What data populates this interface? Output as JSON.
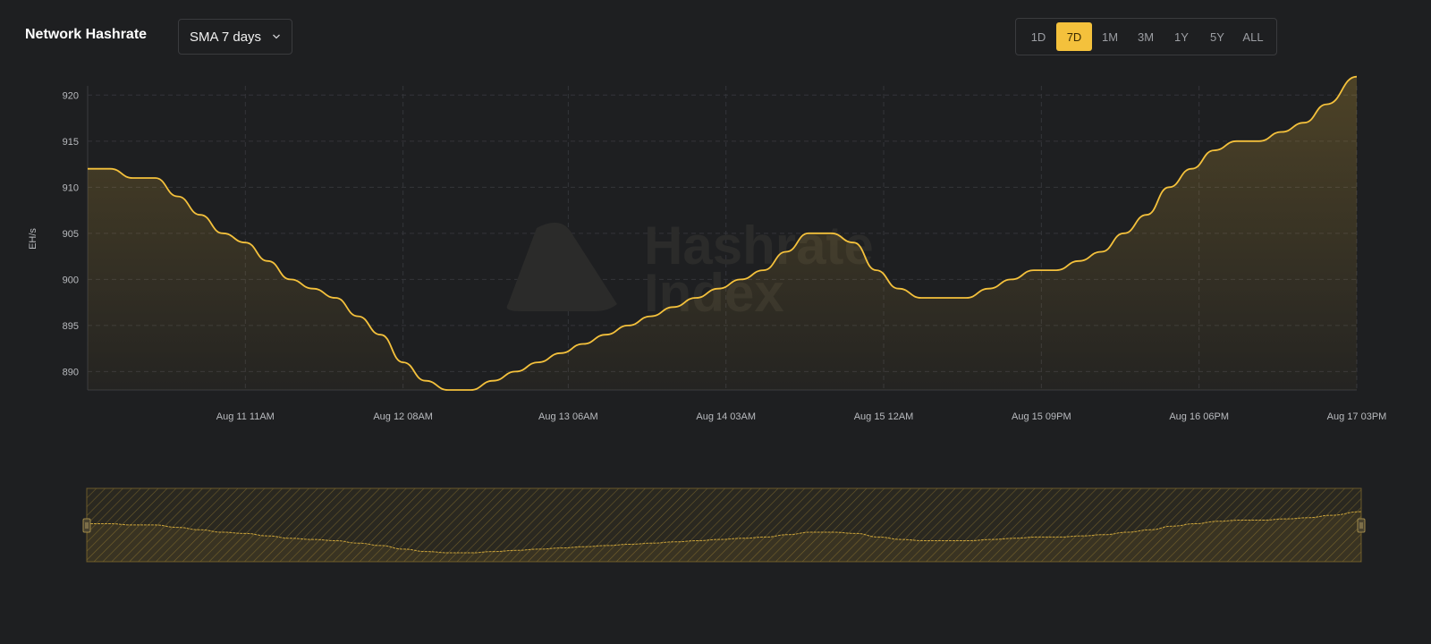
{
  "header": {
    "title": "Network Hashrate",
    "sma_select": {
      "value": "SMA 7 days"
    }
  },
  "range_buttons": [
    "1D",
    "7D",
    "1M",
    "3M",
    "1Y",
    "5Y",
    "ALL"
  ],
  "active_range": "7D",
  "watermark": {
    "line1": "Hashrate",
    "line2": "Index"
  },
  "colors": {
    "accent": "#f4c13c",
    "background": "#1e1f21",
    "grid": "#34353a",
    "text_muted": "#b9bbbf"
  },
  "chart_data": {
    "type": "area",
    "title": "Network Hashrate",
    "ylabel": "EH/s",
    "xlabel": "",
    "ylim": [
      888,
      921
    ],
    "yticks": [
      890,
      895,
      900,
      905,
      910,
      915,
      920
    ],
    "xlim": [
      "Aug 10 14:00",
      "Aug 17 15:00"
    ],
    "xticks": [
      {
        "t": "Aug 11 11:00",
        "label": "Aug 11 11AM"
      },
      {
        "t": "Aug 12 08:00",
        "label": "Aug 12 08AM"
      },
      {
        "t": "Aug 13 06:00",
        "label": "Aug 13 06AM"
      },
      {
        "t": "Aug 14 03:00",
        "label": "Aug 14 03AM"
      },
      {
        "t": "Aug 15 00:00",
        "label": "Aug 15 12AM"
      },
      {
        "t": "Aug 15 21:00",
        "label": "Aug 15 09PM"
      },
      {
        "t": "Aug 16 18:00",
        "label": "Aug 16 06PM"
      },
      {
        "t": "Aug 17 15:00",
        "label": "Aug 17 03PM"
      }
    ],
    "grid": true,
    "series": [
      {
        "values": [
          [
            "Aug 10 14:00",
            912
          ],
          [
            "Aug 10 17:00",
            912
          ],
          [
            "Aug 10 20:00",
            911
          ],
          [
            "Aug 10 23:00",
            911
          ],
          [
            "Aug 11 02:00",
            909
          ],
          [
            "Aug 11 05:00",
            907
          ],
          [
            "Aug 11 08:00",
            905
          ],
          [
            "Aug 11 11:00",
            904
          ],
          [
            "Aug 11 14:00",
            902
          ],
          [
            "Aug 11 17:00",
            900
          ],
          [
            "Aug 11 20:00",
            899
          ],
          [
            "Aug 11 23:00",
            898
          ],
          [
            "Aug 12 02:00",
            896
          ],
          [
            "Aug 12 05:00",
            894
          ],
          [
            "Aug 12 08:00",
            891
          ],
          [
            "Aug 12 11:00",
            889
          ],
          [
            "Aug 12 14:00",
            888
          ],
          [
            "Aug 12 17:00",
            888
          ],
          [
            "Aug 12 20:00",
            889
          ],
          [
            "Aug 12 23:00",
            890
          ],
          [
            "Aug 13 02:00",
            891
          ],
          [
            "Aug 13 05:00",
            892
          ],
          [
            "Aug 13 08:00",
            893
          ],
          [
            "Aug 13 11:00",
            894
          ],
          [
            "Aug 13 14:00",
            895
          ],
          [
            "Aug 13 17:00",
            896
          ],
          [
            "Aug 13 20:00",
            897
          ],
          [
            "Aug 13 23:00",
            898
          ],
          [
            "Aug 14 02:00",
            899
          ],
          [
            "Aug 14 05:00",
            900
          ],
          [
            "Aug 14 08:00",
            901
          ],
          [
            "Aug 14 11:00",
            903
          ],
          [
            "Aug 14 14:00",
            905
          ],
          [
            "Aug 14 17:00",
            905
          ],
          [
            "Aug 14 20:00",
            904
          ],
          [
            "Aug 14 23:00",
            901
          ],
          [
            "Aug 15 02:00",
            899
          ],
          [
            "Aug 15 05:00",
            898
          ],
          [
            "Aug 15 08:00",
            898
          ],
          [
            "Aug 15 11:00",
            898
          ],
          [
            "Aug 15 14:00",
            899
          ],
          [
            "Aug 15 17:00",
            900
          ],
          [
            "Aug 15 20:00",
            901
          ],
          [
            "Aug 15 23:00",
            901
          ],
          [
            "Aug 16 02:00",
            902
          ],
          [
            "Aug 16 05:00",
            903
          ],
          [
            "Aug 16 08:00",
            905
          ],
          [
            "Aug 16 11:00",
            907
          ],
          [
            "Aug 16 14:00",
            910
          ],
          [
            "Aug 16 17:00",
            912
          ],
          [
            "Aug 16 20:00",
            914
          ],
          [
            "Aug 16 23:00",
            915
          ],
          [
            "Aug 17 02:00",
            915
          ],
          [
            "Aug 17 05:00",
            916
          ],
          [
            "Aug 17 08:00",
            917
          ],
          [
            "Aug 17 11:00",
            919
          ],
          [
            "Aug 17 15:00",
            922
          ]
        ]
      }
    ]
  }
}
